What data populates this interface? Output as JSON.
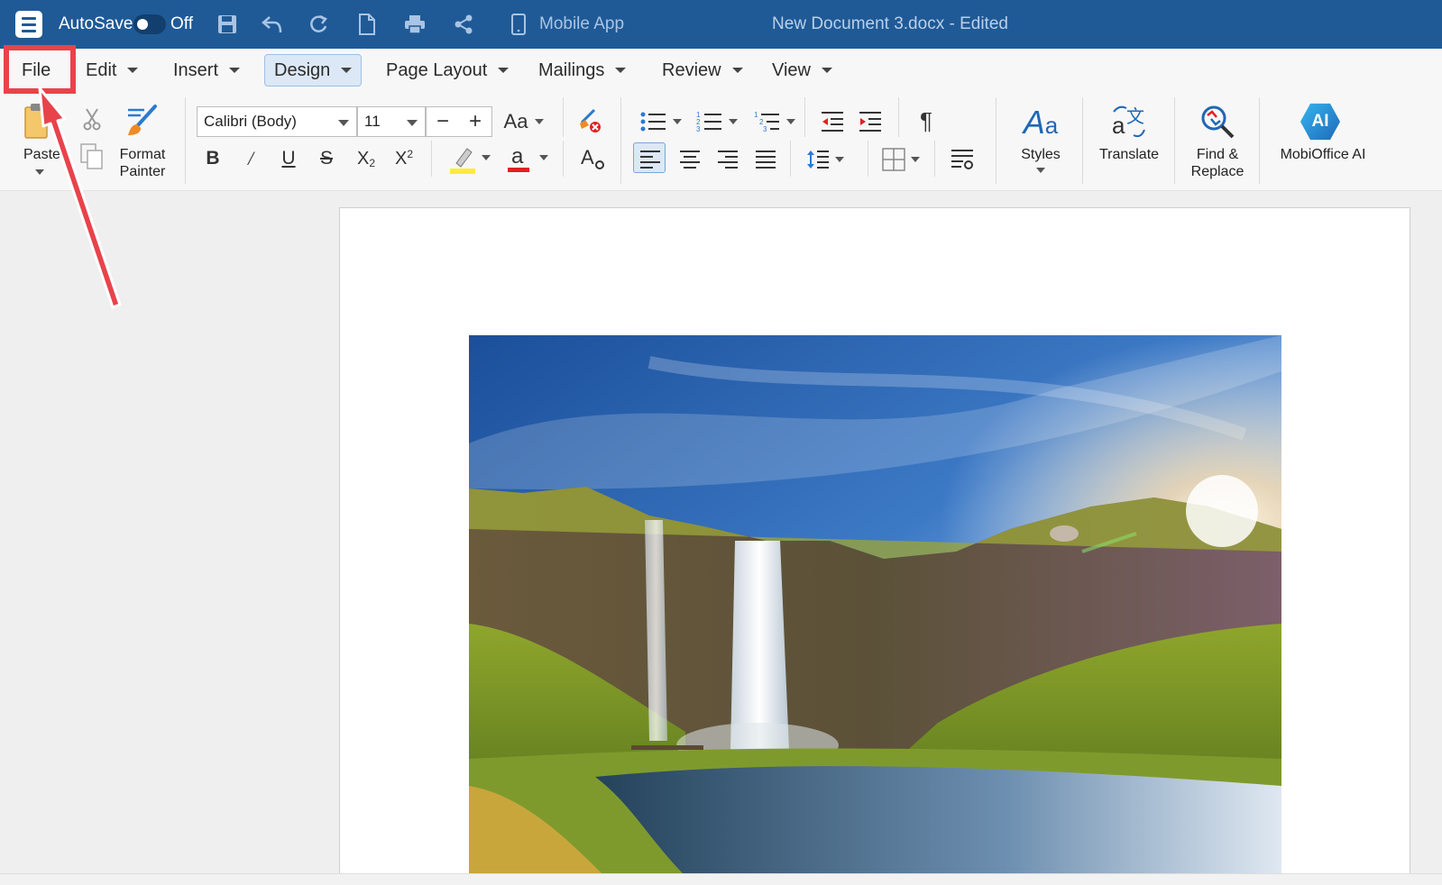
{
  "titlebar": {
    "autosave_label": "AutoSave",
    "autosave_state": "Off",
    "mobile_app_label": "Mobile App",
    "document_title": "New Document 3.docx - Edited"
  },
  "menubar": {
    "items": [
      {
        "label": "File"
      },
      {
        "label": "Edit"
      },
      {
        "label": "Insert"
      },
      {
        "label": "Design"
      },
      {
        "label": "Page Layout"
      },
      {
        "label": "Mailings"
      },
      {
        "label": "Review"
      },
      {
        "label": "View"
      }
    ]
  },
  "ribbon": {
    "paste_label": "Paste",
    "format_painter_label_1": "Format",
    "format_painter_label_2": "Painter",
    "font_name": "Calibri (Body)",
    "font_size": "11",
    "change_case_label": "Aa",
    "styles_label": "Styles",
    "translate_label": "Translate",
    "find_replace_label_1": "Find &",
    "find_replace_label_2": "Replace",
    "ai_label": "MobiOffice AI",
    "ai_badge": "AI"
  },
  "colors": {
    "titlebar": "#1f5a96",
    "highlight_annotation": "#e8434b",
    "highlight_color": "#ffeb3b",
    "font_color": "#e02020"
  }
}
